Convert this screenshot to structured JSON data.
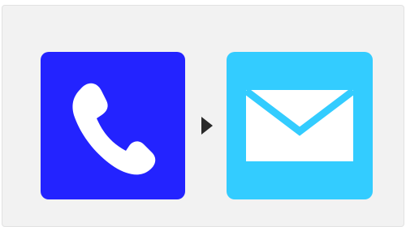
{
  "workflow": {
    "source": {
      "icon": "phone-icon",
      "color": "#2323ff",
      "glyph_color": "#ffffff"
    },
    "connector": {
      "icon": "arrow-right-icon",
      "color": "#2a2a2a"
    },
    "target": {
      "icon": "mail-icon",
      "color": "#33ccff",
      "glyph_color": "#ffffff"
    }
  }
}
